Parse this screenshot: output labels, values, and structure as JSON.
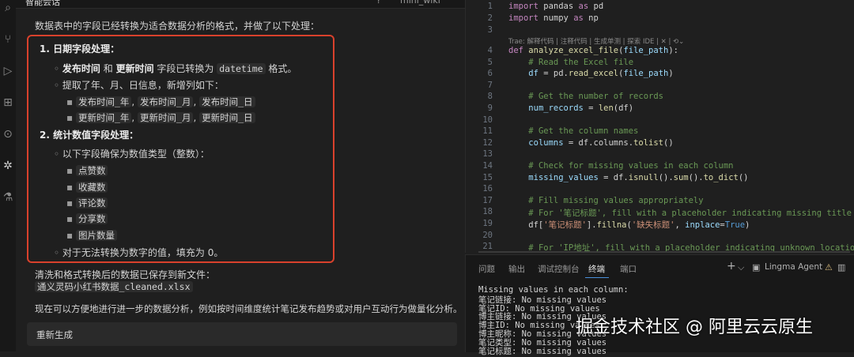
{
  "activity_bar": {
    "icons": [
      "search-icon",
      "source-control-icon",
      "run-debug-icon",
      "extensions-icon",
      "remote-icon",
      "lingma-icon",
      "testing-icon"
    ]
  },
  "chat": {
    "header": {
      "title": "智能会话",
      "help_icon": "?",
      "user": "mini_wiki"
    },
    "intro": "数据表中的字段已经转换为适合数据分析的格式，并做了以下处理：",
    "section1": {
      "title": "1. 日期字段处理：",
      "item1_part1": "发布时间",
      "item1_and": " 和 ",
      "item1_part2": "更新时间",
      "item1_mid": " 字段已转换为 ",
      "item1_code": "datetime",
      "item1_end": " 格式。",
      "item2": "提取了年、月、日信息，新增列如下：",
      "cols_row1": [
        "发布时间_年",
        "发布时间_月",
        "发布时间_日"
      ],
      "cols_row2": [
        "更新时间_年",
        "更新时间_月",
        "更新时间_日"
      ],
      "separator": ", "
    },
    "section2": {
      "title": "2. 统计数值字段处理：",
      "item1": "以下字段确保为数值类型（整数）：",
      "fields": [
        "点赞数",
        "收藏数",
        "评论数",
        "分享数",
        "图片数量"
      ],
      "item2": "对于无法转换为数字的值，填充为 0。"
    },
    "saved_text": "清洗和格式转换后的数据已保存到新文件：",
    "saved_file": "通义灵码小红书数据_cleaned.xlsx",
    "closing": "现在可以方便地进行进一步的数据分析，例如按时间维度统计笔记发布趋势或对用户互动行为做量化分析。",
    "regen_button": "重新生成"
  },
  "editor": {
    "code_lens": "Trae: 解释代码 | 注释代码 | 生成单测 | 探索 IDE | ✕ | ⟲⌄",
    "lines": [
      {
        "n": "1",
        "s": [
          [
            "kw",
            "import"
          ],
          [
            "plain",
            " pandas "
          ],
          [
            "kw",
            "as"
          ],
          [
            "plain",
            " pd"
          ]
        ]
      },
      {
        "n": "2",
        "s": [
          [
            "kw",
            "import"
          ],
          [
            "plain",
            " numpy "
          ],
          [
            "kw",
            "as"
          ],
          [
            "plain",
            " np"
          ]
        ]
      },
      {
        "n": "3",
        "s": []
      },
      {
        "n": "4",
        "s": [
          [
            "kw",
            "def"
          ],
          [
            "plain",
            " "
          ],
          [
            "fn",
            "analyze_excel_file"
          ],
          [
            "plain",
            "("
          ],
          [
            "var",
            "file_path"
          ],
          [
            "plain",
            "):"
          ]
        ]
      },
      {
        "n": "5",
        "s": [
          [
            "plain",
            "    "
          ],
          [
            "cm",
            "# Read the Excel file"
          ]
        ]
      },
      {
        "n": "6",
        "s": [
          [
            "plain",
            "    "
          ],
          [
            "var",
            "df"
          ],
          [
            "plain",
            " = pd."
          ],
          [
            "fn",
            "read_excel"
          ],
          [
            "plain",
            "("
          ],
          [
            "var",
            "file_path"
          ],
          [
            "plain",
            ")"
          ]
        ]
      },
      {
        "n": "7",
        "s": []
      },
      {
        "n": "8",
        "s": [
          [
            "plain",
            "    "
          ],
          [
            "cm",
            "# Get the number of records"
          ]
        ]
      },
      {
        "n": "9",
        "s": [
          [
            "plain",
            "    "
          ],
          [
            "var",
            "num_records"
          ],
          [
            "plain",
            " = "
          ],
          [
            "fn",
            "len"
          ],
          [
            "plain",
            "(df)"
          ]
        ]
      },
      {
        "n": "10",
        "s": []
      },
      {
        "n": "11",
        "s": [
          [
            "plain",
            "    "
          ],
          [
            "cm",
            "# Get the column names"
          ]
        ]
      },
      {
        "n": "12",
        "s": [
          [
            "plain",
            "    "
          ],
          [
            "var",
            "columns"
          ],
          [
            "plain",
            " = df.columns."
          ],
          [
            "fn",
            "tolist"
          ],
          [
            "plain",
            "()"
          ]
        ]
      },
      {
        "n": "13",
        "s": []
      },
      {
        "n": "14",
        "s": [
          [
            "plain",
            "    "
          ],
          [
            "cm",
            "# Check for missing values in each column"
          ]
        ]
      },
      {
        "n": "15",
        "s": [
          [
            "plain",
            "    "
          ],
          [
            "var",
            "missing_values"
          ],
          [
            "plain",
            " = df."
          ],
          [
            "fn",
            "isnull"
          ],
          [
            "plain",
            "()."
          ],
          [
            "fn",
            "sum"
          ],
          [
            "plain",
            "()."
          ],
          [
            "fn",
            "to_dict"
          ],
          [
            "plain",
            "()"
          ]
        ]
      },
      {
        "n": "16",
        "s": []
      },
      {
        "n": "17",
        "s": [
          [
            "plain",
            "    "
          ],
          [
            "cm",
            "# Fill missing values appropriately"
          ]
        ]
      },
      {
        "n": "18",
        "s": [
          [
            "plain",
            "    "
          ],
          [
            "cm",
            "# For '笔记标题', fill with a placeholder indicating missing title"
          ]
        ]
      },
      {
        "n": "19",
        "s": [
          [
            "plain",
            "    df["
          ],
          [
            "str",
            "'笔记标题'"
          ],
          [
            "plain",
            "]."
          ],
          [
            "fn",
            "fillna"
          ],
          [
            "plain",
            "("
          ],
          [
            "str",
            "'缺失标题'"
          ],
          [
            "plain",
            ", "
          ],
          [
            "var",
            "inplace"
          ],
          [
            "plain",
            "="
          ],
          [
            "bool",
            "True"
          ],
          [
            "plain",
            ")"
          ]
        ]
      },
      {
        "n": "20",
        "s": []
      },
      {
        "n": "21",
        "s": [
          [
            "plain",
            "    "
          ],
          [
            "cm",
            "# For 'IP地址', fill with a placeholder indicating unknown location"
          ]
        ]
      }
    ]
  },
  "panel": {
    "tabs": [
      "问题",
      "输出",
      "调试控制台",
      "终端",
      "端口"
    ],
    "active_tab": "终端",
    "right": {
      "add": "+",
      "chevron": "⌵",
      "terminal_name": "Lingma Agent",
      "warning": "⚠",
      "split": "▥",
      "more": "···"
    },
    "terminal_lines": [
      "Missing values in each column:",
      "笔记链接: No missing values",
      "笔记ID: No missing values",
      "博主链接: No missing values",
      "博主ID: No missing values",
      "博主昵称: No missing values",
      "笔记类型: No missing values",
      "笔记标题: No missing values"
    ]
  },
  "watermark": "掘金技术社区 @ 阿里云云原生"
}
